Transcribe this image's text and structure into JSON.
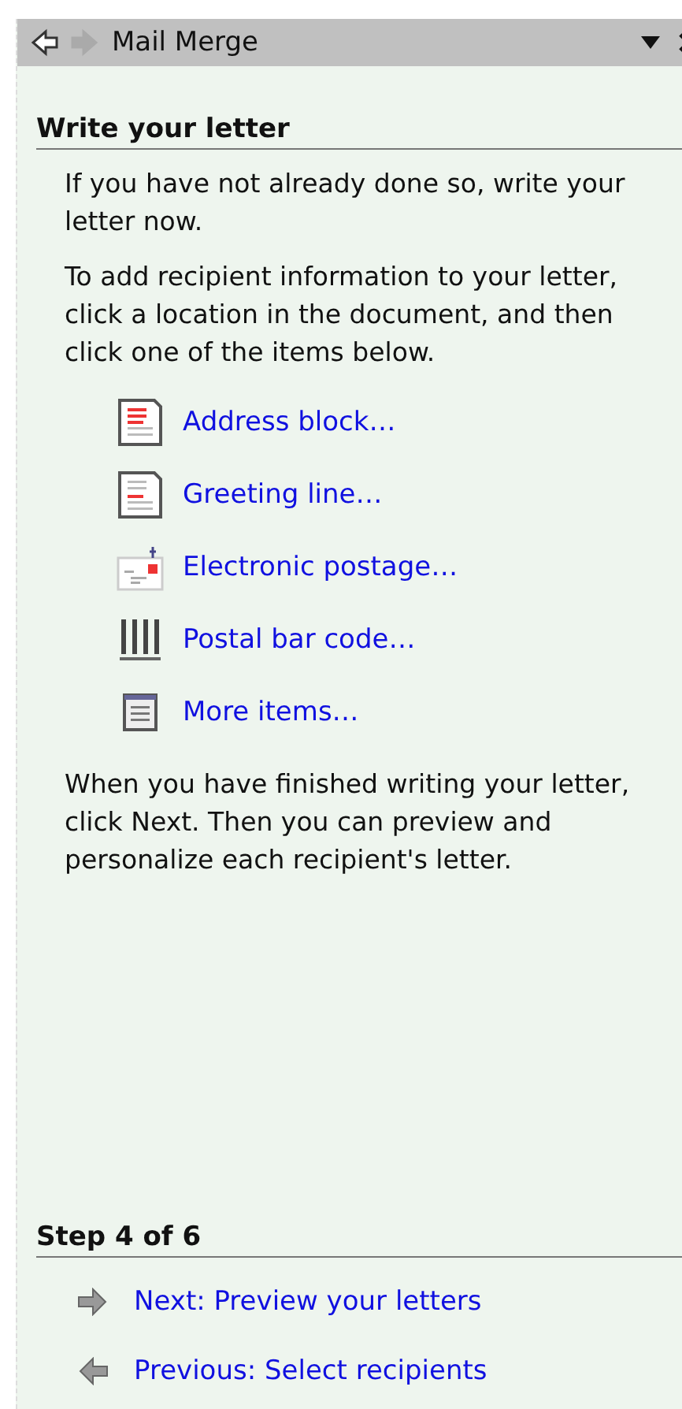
{
  "window": {
    "title": "Mail Merge",
    "back_disabled": false,
    "forward_disabled": true
  },
  "section": {
    "heading": "Write your letter",
    "paragraphs": [
      "If you have not already done so, write your letter now.",
      "To add recipient information to your letter, click a location in the document, and then click one of the items below."
    ],
    "items": [
      {
        "kind": "address",
        "label": "Address block…"
      },
      {
        "kind": "greeting",
        "label": "Greeting line…"
      },
      {
        "kind": "postage",
        "label": "Electronic postage…"
      },
      {
        "kind": "barcode",
        "label": "Postal bar code…"
      },
      {
        "kind": "more",
        "label": "More items…"
      }
    ],
    "footer_text": "When you have finished writing your letter, click Next. Then you can preview and personalize each recipient's letter."
  },
  "step": {
    "heading": "Step 4 of 6",
    "links": [
      {
        "kind": "next",
        "label": "Next: Preview your letters"
      },
      {
        "kind": "previous",
        "label": "Previous: Select recipients"
      }
    ]
  }
}
